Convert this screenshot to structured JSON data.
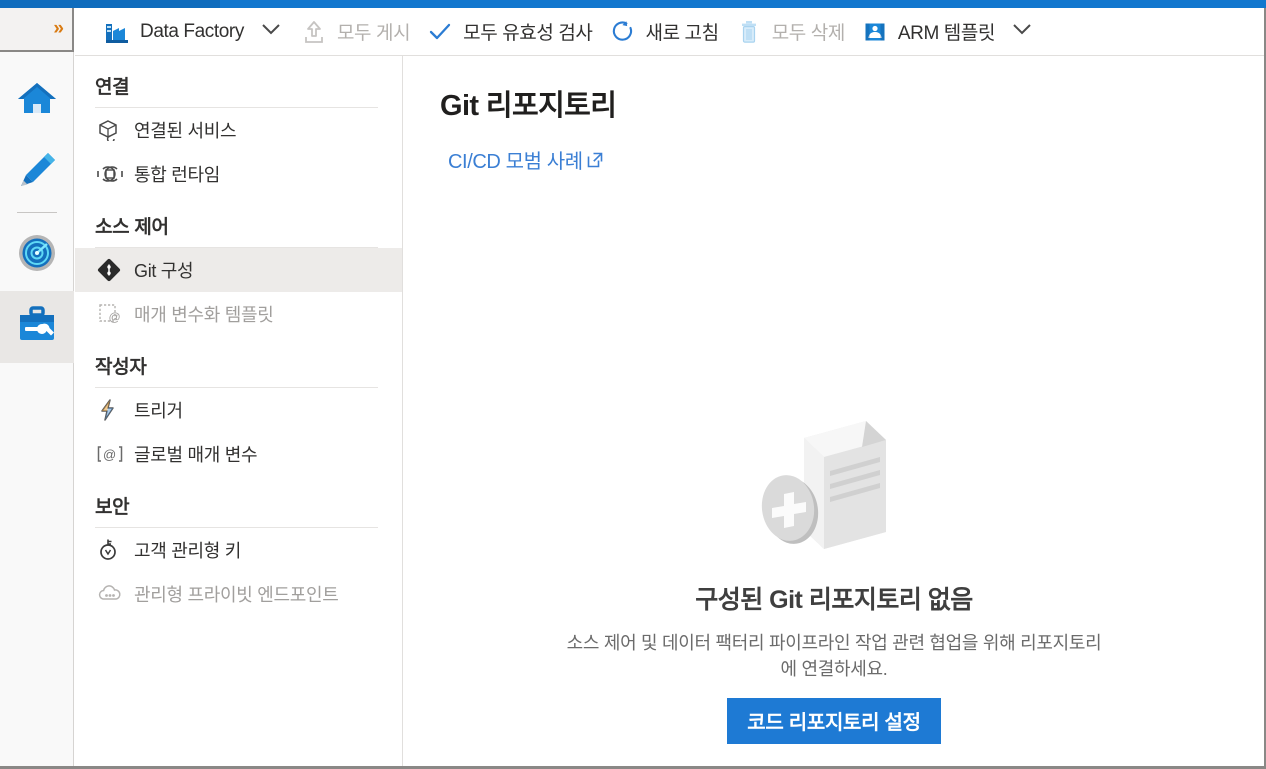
{
  "theme": {
    "accent": "#0f6cbd",
    "link": "#3b7fd4",
    "button_bg": "#1e7ad4",
    "selected_row_bg": "#edebe9",
    "text": "#323130",
    "disabled_text": "#a19f9d"
  },
  "rail": {
    "expand_label": "»",
    "expand_icon": "chevron-double-right-icon",
    "items": [
      {
        "name": "home",
        "icon": "home-icon",
        "selected": false
      },
      {
        "name": "author",
        "icon": "pencil-icon",
        "selected": false
      },
      {
        "name": "monitor",
        "icon": "radar-monitor-icon",
        "selected": false
      },
      {
        "name": "manage",
        "icon": "toolbox-wrench-icon",
        "selected": true
      }
    ]
  },
  "commandbar": {
    "factory": {
      "label": "Data Factory",
      "icon": "factory-icon"
    },
    "factory_chevron": "chevron-down-icon",
    "commands": [
      {
        "name": "publish-all",
        "label": "모두 게시",
        "icon": "publish-upload-icon",
        "disabled": true
      },
      {
        "name": "validate-all",
        "label": "모두 유효성 검사",
        "icon": "checkmark-icon",
        "disabled": false
      },
      {
        "name": "refresh",
        "label": "새로 고침",
        "icon": "refresh-icon",
        "disabled": false
      },
      {
        "name": "discard-all",
        "label": "모두 삭제",
        "icon": "trash-icon",
        "disabled": true
      },
      {
        "name": "arm-template",
        "label": "ARM 템플릿",
        "icon": "arm-template-icon",
        "disabled": false
      }
    ],
    "end_chevron": "chevron-down-icon"
  },
  "sidebar": {
    "sections": [
      {
        "header": "연결",
        "items": [
          {
            "name": "linked-services",
            "label": "연결된 서비스",
            "icon": "linked-services-icon",
            "selected": false,
            "disabled": false
          },
          {
            "name": "integration-runtimes",
            "label": "통합 런타임",
            "icon": "integration-runtime-icon",
            "selected": false,
            "disabled": false
          }
        ]
      },
      {
        "header": "소스 제어",
        "items": [
          {
            "name": "git-configuration",
            "label": "Git 구성",
            "icon": "git-icon",
            "selected": true,
            "disabled": false
          },
          {
            "name": "parameterization-template",
            "label": "매개 변수화 템플릿",
            "icon": "parameterization-icon",
            "selected": false,
            "disabled": true
          }
        ]
      },
      {
        "header": "작성자",
        "items": [
          {
            "name": "triggers",
            "label": "트리거",
            "icon": "lightning-trigger-icon",
            "selected": false,
            "disabled": false
          },
          {
            "name": "global-parameters",
            "label": "글로벌 매개 변수",
            "icon": "global-parameter-icon",
            "selected": false,
            "disabled": false
          }
        ]
      },
      {
        "header": "보안",
        "items": [
          {
            "name": "customer-managed-key",
            "label": "고객 관리형 키",
            "icon": "key-icon",
            "selected": false,
            "disabled": false
          },
          {
            "name": "managed-private-endpoints",
            "label": "관리형 프라이빗 엔드포인트",
            "icon": "cloud-endpoint-icon",
            "selected": false,
            "disabled": true
          }
        ]
      }
    ]
  },
  "main": {
    "title": "Git 리포지토리",
    "cicd_link": {
      "label": "CI/CD 모범 사례",
      "icon": "external-link-icon"
    },
    "empty_state": {
      "illustration": "document-add-illustration",
      "title": "구성된 Git 리포지토리 없음",
      "description": "소스 제어 및 데이터 팩터리 파이프라인 작업 관련 협업을 위해 리포지토리에 연결하세요.",
      "button_label": "코드 리포지토리 설정"
    }
  }
}
